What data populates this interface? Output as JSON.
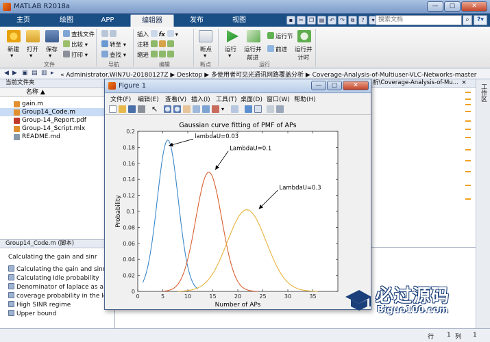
{
  "window": {
    "title": "MATLAB R2018a"
  },
  "tabs": [
    "主页",
    "绘图",
    "APP",
    "编辑器",
    "发布",
    "视图"
  ],
  "search": {
    "placeholder": "搜索文档"
  },
  "ribbon": {
    "file": {
      "new": "新建",
      "open": "打开",
      "save": "保存",
      "find_files": "查找文件",
      "compare": "比较",
      "print": "打印",
      "group": "文件"
    },
    "navigate": {
      "goto": "转至",
      "find": "查找",
      "group": "导航"
    },
    "edit": {
      "insert": "插入",
      "comment": "注释",
      "indent": "缩进",
      "group": "编辑"
    },
    "breakpoints": {
      "label": "断点",
      "group": "断点"
    },
    "run": {
      "run": "运行",
      "run_advance": "运行并\n前进",
      "run_section": "运行节",
      "advance": "前进",
      "run_time": "运行并\n计时",
      "group": "运行"
    }
  },
  "address": {
    "path": "« Administrator.WIN7U-20180127Z  ▶  Desktop  ▶  多使用者可见光通讯网路覆盖分析  ▶  Coverage-Analysis-of-Multiuser-VLC-Networks-master"
  },
  "current_folder": {
    "title": "当前文件夹",
    "column": "名称 ▲",
    "files": [
      {
        "name": "gain.m",
        "color": "#e09030"
      },
      {
        "name": "Group14_Code.m",
        "color": "#e09030"
      },
      {
        "name": "Group-14_Report.pdf",
        "color": "#c0392b"
      },
      {
        "name": "Group-14_Script.mlx",
        "color": "#e09030"
      },
      {
        "name": "README.md",
        "color": "#8899aa"
      }
    ]
  },
  "details": {
    "title": "Group14_Code.m  (脚本)",
    "header": "Calculating the gain and sinr",
    "items": [
      "Calculating the gain and sinr",
      "Calculating Idle probability",
      "Denominator of laplace as a f...",
      "coverage probability in the lo...",
      "High SINR regime",
      "Upper bound"
    ]
  },
  "editor": {
    "tab_title": "析\\Coverage-Analysis-of-Mu...",
    "close": "×"
  },
  "right_label": "工作区",
  "status": {
    "row_label": "行",
    "row_value": "1",
    "col_label": "列",
    "col_value": "1"
  },
  "figure": {
    "title": "Figure 1",
    "menu": [
      "文件(F)",
      "编辑(E)",
      "查看(V)",
      "插入(I)",
      "工具(T)",
      "桌面(D)",
      "窗口(W)",
      "帮助(H)"
    ]
  },
  "chart_data": {
    "type": "line",
    "title": "Gaussian curve fitting of PMF of APs",
    "xlabel": "Number of APs",
    "ylabel": "Probability",
    "xlim": [
      0,
      40
    ],
    "ylim": [
      0,
      0.2
    ],
    "xticks": [
      0,
      5,
      10,
      15,
      20,
      25,
      30,
      35
    ],
    "yticks": [
      0,
      0.02,
      0.04,
      0.06,
      0.08,
      0.1,
      0.12,
      0.14,
      0.16,
      0.18,
      0.2
    ],
    "grid": false,
    "series": [
      {
        "color": "#3a87c8",
        "mean": 6,
        "sd": 2.1,
        "peak": 0.189,
        "xrange": [
          1,
          12
        ]
      },
      {
        "color": "#d9602f",
        "mean": 14.2,
        "sd": 2.6,
        "peak": 0.149,
        "xrange": [
          5,
          24
        ]
      },
      {
        "color": "#e8b13a",
        "mean": 21.8,
        "sd": 3.9,
        "peak": 0.102,
        "xrange": [
          8,
          36
        ]
      }
    ],
    "annotations": [
      {
        "text": "lambdaU=0.03",
        "point": [
          6.2,
          0.182
        ],
        "text_at": [
          13.3,
          0.193
        ]
      },
      {
        "text": "LambdaU=0.1",
        "point": [
          15.5,
          0.152
        ],
        "text_at": [
          20.3,
          0.178
        ]
      },
      {
        "text": "LambdaU=0.3",
        "point": [
          24.2,
          0.103
        ],
        "text_at": [
          30.2,
          0.129
        ]
      }
    ]
  },
  "watermark": {
    "cn": "必过源码",
    "en": "Biguo100.com"
  }
}
